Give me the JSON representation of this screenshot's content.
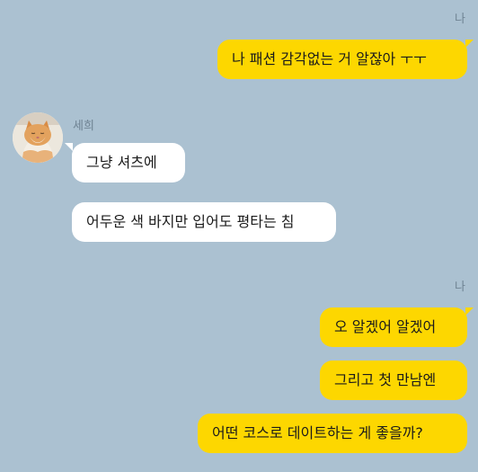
{
  "chat": {
    "me_label_top": "나",
    "me_label_bottom": "나",
    "contact_name": "세희",
    "contact_avatar_icon": "cat-photo-avatar",
    "messages": [
      {
        "sender": "me",
        "text": "나 패션 감각없는 거 알잖아 ㅜㅜ"
      },
      {
        "sender": "other",
        "text": "그냥 셔츠에"
      },
      {
        "sender": "other",
        "text": "어두운 색 바지만 입어도 평타는 침"
      },
      {
        "sender": "me",
        "text": "오 알겠어 알겠어"
      },
      {
        "sender": "me",
        "text": "그리고 첫 만남엔"
      },
      {
        "sender": "me",
        "text": "어떤 코스로 데이트하는 게 좋을까?"
      }
    ]
  },
  "colors": {
    "background": "#abc1d1",
    "my_bubble": "#fdd700",
    "their_bubble": "#ffffff"
  }
}
